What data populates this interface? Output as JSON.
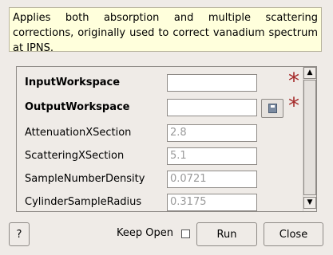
{
  "description": "Applies both absorption and multiple scattering corrections, originally used to correct vanadium spectrum at IPNS.",
  "properties": [
    {
      "label": "InputWorkspace",
      "value": "",
      "required": true
    },
    {
      "label": "OutputWorkspace",
      "value": "",
      "required": true
    },
    {
      "label": "AttenuationXSection",
      "placeholder": "2.8"
    },
    {
      "label": "ScatteringXSection",
      "placeholder": "5.1"
    },
    {
      "label": "SampleNumberDensity",
      "placeholder": "0.0721"
    },
    {
      "label": "CylinderSampleRadius",
      "placeholder": "0.3175"
    }
  ],
  "required_marker": "*",
  "scrollbar": {
    "up_arrow": "▲",
    "down_arrow": "▼"
  },
  "footer": {
    "help_label": "?",
    "keep_open_label": "Keep Open",
    "run_label": "Run",
    "close_label": "Close"
  },
  "colors": {
    "required_star": "#a52a2a",
    "description_bg": "#ffffdc"
  },
  "icons": {
    "browse": "folder-browse-icon",
    "required": "required-star-icon"
  }
}
